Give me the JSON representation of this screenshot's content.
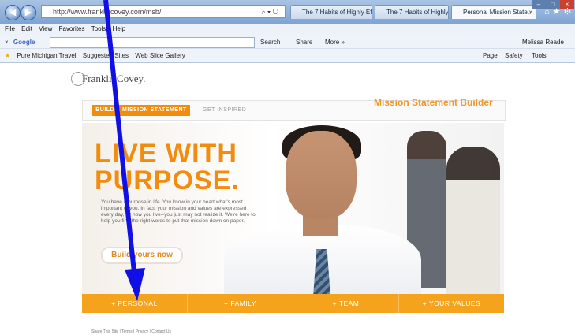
{
  "browser": {
    "address": "http://www.franklincovey.com/msb/",
    "tabs": [
      "The 7 Habits of Highly Eff...",
      "The 7 Habits of Highly Eff...",
      "Personal Mission State..."
    ],
    "menu": [
      "File",
      "Edit",
      "View",
      "Favorites",
      "Tools",
      "Help"
    ],
    "google_label": "Google",
    "google_search": "Search",
    "google_share": "Share",
    "google_more": "More »",
    "google_user": "Melissa Reade",
    "favorites": [
      "Pure Michigan Travel",
      "Suggested Sites",
      "Web Slice Gallery"
    ],
    "command_items": [
      "Page",
      "Safety",
      "Tools"
    ]
  },
  "page": {
    "logo": "FranklinCovey.",
    "subnav_active": "BUILD A MISSION STATEMENT",
    "subnav_other": "GET INSPIRED",
    "builder_title": "Mission Statement Builder",
    "headline_line1": "LIVE WITH",
    "headline_line2": "PURPOSE.",
    "intro": "You have a purpose in life. You know in your heart what's most important to you. In fact, your mission and values are expressed every day, by how you live--you just may not realize it. We're here to help you find the right words to put that mission down on paper.",
    "cta": "Build yours now",
    "bottom_nav": [
      "+ PERSONAL",
      "+ FAMILY",
      "+ TEAM",
      "+ YOUR VALUES"
    ],
    "footer": "Share This Site | Terms | Privacy | Contact Us"
  },
  "colors": {
    "brand_orange": "#f28c0d",
    "nav_orange": "#f5a31c",
    "annotation_arrow": "#1010e6"
  }
}
